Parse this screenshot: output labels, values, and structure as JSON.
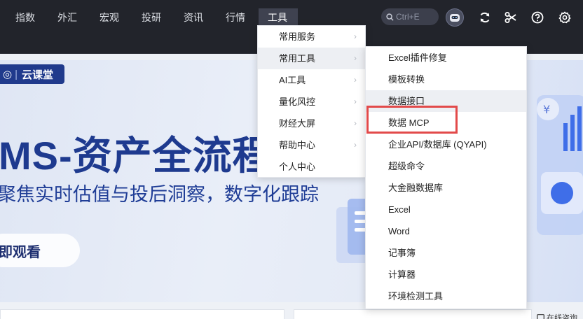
{
  "nav": {
    "items": [
      {
        "label": "指数"
      },
      {
        "label": "外汇"
      },
      {
        "label": "宏观"
      },
      {
        "label": "投研"
      },
      {
        "label": "资讯"
      },
      {
        "label": "行情"
      },
      {
        "label": "工具",
        "active": true
      }
    ],
    "search": {
      "placeholder": "Ctrl+E"
    },
    "icons": [
      "search-icon",
      "robot-icon",
      "refresh-icon",
      "scissors-icon",
      "help-icon",
      "settings-icon"
    ]
  },
  "banner": {
    "logo_text": "云课堂",
    "title": "MS-资产全流程",
    "subtitle": "聚焦实时估值与投后洞察，数字化跟踪",
    "button_label": "即观看"
  },
  "tools_menu": {
    "items": [
      {
        "label": "常用服务"
      },
      {
        "label": "常用工具",
        "active": true
      },
      {
        "label": "AI工具"
      },
      {
        "label": "量化风控"
      },
      {
        "label": "财经大屏"
      },
      {
        "label": "帮助中心"
      },
      {
        "label": "个人中心"
      }
    ]
  },
  "tools_submenu": {
    "items": [
      {
        "label": "Excel插件修复"
      },
      {
        "label": "模板转换"
      },
      {
        "label": "数据接口",
        "hover": true
      },
      {
        "label": "数据 MCP",
        "highlighted": true
      },
      {
        "label": "企业API/数据库 (QYAPI)"
      },
      {
        "label": "超级命令"
      },
      {
        "label": "大金融数据库"
      },
      {
        "label": "Excel"
      },
      {
        "label": "Word"
      },
      {
        "label": "记事簿"
      },
      {
        "label": "计算器"
      },
      {
        "label": "环境检测工具"
      }
    ]
  },
  "footer": {
    "online_label": "在线咨询"
  },
  "colors": {
    "topbar": "#22242b",
    "accent_blue": "#1e3a8f",
    "highlight_red": "#e24a4a"
  }
}
